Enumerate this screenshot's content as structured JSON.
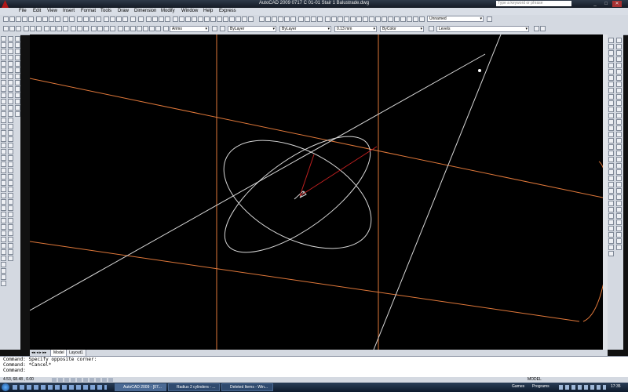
{
  "window": {
    "title": "AutoCAD 2009  0717 C 01-01 Stair 1 Balustrade.dwg",
    "search_placeholder": "Type a keyword or phrase",
    "minimize": "_",
    "restore": "□",
    "close": "✕"
  },
  "menu": [
    "File",
    "Edit",
    "View",
    "Insert",
    "Format",
    "Tools",
    "Draw",
    "Dimension",
    "Modify",
    "Window",
    "Help",
    "Express"
  ],
  "toolbars": {
    "view_combo": "Unnamed",
    "text_style": "Arimo",
    "layer": "ByLayer",
    "linetype": "ByLayer",
    "lineweight": "0.13 mm",
    "plotstyle": "ByColor",
    "layer_state": "Levels"
  },
  "tabs": [
    "Model",
    "Layout1"
  ],
  "command_lines": [
    "Command: Specify opposite corner:",
    "Command: *Cancel*",
    "Command:"
  ],
  "status": {
    "coords": "4.53,  68.48 , 0.00",
    "space": "MODEL"
  },
  "taskbar": {
    "items": [
      {
        "label": "AutoCAD 2009 - [07...",
        "active": true
      },
      {
        "label": "Radius 2 cylinders - ...",
        "active": false
      },
      {
        "label": "Deleted Items - Win...",
        "active": false
      }
    ],
    "games": "Games",
    "programs": "Programs",
    "clock": "17:35"
  },
  "colors": {
    "model_space": "#000000",
    "orange_lines": "#e0783a",
    "white_lines": "#d8d8d8",
    "red_vector": "#c02020"
  }
}
